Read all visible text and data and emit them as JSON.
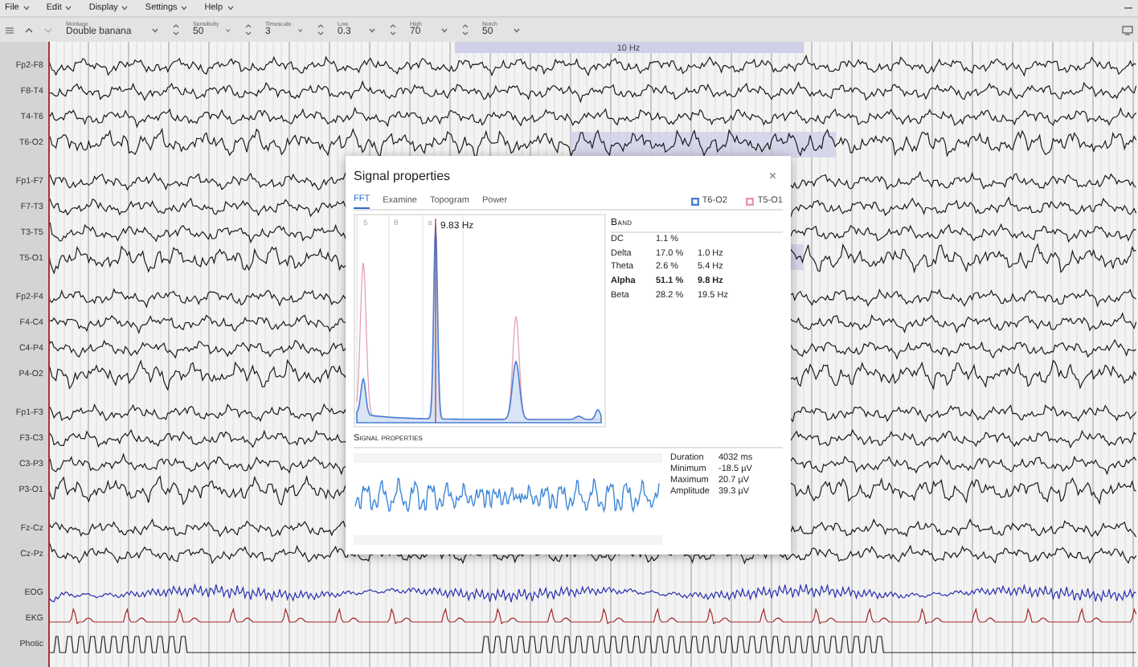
{
  "menu": [
    {
      "label": "File"
    },
    {
      "label": "Edit"
    },
    {
      "label": "Display"
    },
    {
      "label": "Settings"
    },
    {
      "label": "Help"
    }
  ],
  "toolbar": {
    "fields": [
      {
        "label": "Montage",
        "value": "Double banana",
        "kind": "dropdown"
      },
      {
        "label": "Sensitivity",
        "value": "50",
        "kind": "spinner"
      },
      {
        "label": "Timescale",
        "value": "3",
        "kind": "spinner"
      },
      {
        "label": "Low",
        "value": "0.3",
        "kind": "spinner"
      },
      {
        "label": "High",
        "value": "70",
        "kind": "spinner"
      },
      {
        "label": "Notch",
        "value": "50",
        "kind": "spinner"
      }
    ]
  },
  "selection": {
    "label": "10 Hz"
  },
  "montage": {
    "groups": [
      {
        "channels": [
          {
            "name": "Fp2-F8",
            "kind": "eeg"
          },
          {
            "name": "F8-T4",
            "kind": "eeg"
          },
          {
            "name": "T4-T6",
            "kind": "eeg"
          },
          {
            "name": "T6-O2",
            "kind": "eeg"
          }
        ]
      },
      {
        "channels": [
          {
            "name": "Fp1-F7",
            "kind": "eeg"
          },
          {
            "name": "F7-T3",
            "kind": "eeg"
          },
          {
            "name": "T3-T5",
            "kind": "eeg"
          },
          {
            "name": "T5-O1",
            "kind": "eeg"
          }
        ]
      },
      {
        "channels": [
          {
            "name": "Fp2-F4",
            "kind": "eeg"
          },
          {
            "name": "F4-C4",
            "kind": "eeg"
          },
          {
            "name": "C4-P4",
            "kind": "eeg"
          },
          {
            "name": "P4-O2",
            "kind": "eeg"
          }
        ]
      },
      {
        "channels": [
          {
            "name": "Fp1-F3",
            "kind": "eeg"
          },
          {
            "name": "F3-C3",
            "kind": "eeg"
          },
          {
            "name": "C3-P3",
            "kind": "eeg"
          },
          {
            "name": "P3-O1",
            "kind": "eeg"
          }
        ]
      },
      {
        "channels": [
          {
            "name": "Fz-Cz",
            "kind": "eeg"
          },
          {
            "name": "Cz-Pz",
            "kind": "eeg"
          }
        ]
      },
      {
        "channels": [
          {
            "name": "EOG",
            "kind": "eog"
          },
          {
            "name": "EKG",
            "kind": "ekg"
          },
          {
            "name": "Photic",
            "kind": "photic"
          }
        ]
      }
    ]
  },
  "dialog": {
    "title": "Signal properties",
    "close": "×",
    "tabs": [
      {
        "label": "FFT",
        "selected": true
      },
      {
        "label": "Examine",
        "selected": false
      },
      {
        "label": "Topogram",
        "selected": false
      },
      {
        "label": "Power",
        "selected": false
      }
    ],
    "legend": [
      {
        "label": "T6-O2",
        "color": "#4a7fd4"
      },
      {
        "label": "T5-O1",
        "color": "#e39aa8"
      }
    ],
    "fft": {
      "band_markers": [
        "δ",
        "θ",
        "α"
      ],
      "peak_label": "9.83 Hz"
    },
    "bands": {
      "heading": "Band",
      "rows": [
        {
          "name": "DC",
          "percent": "1.1 %",
          "highlighted": false
        },
        {
          "name": "Delta",
          "percent": "17.0 %",
          "frequency": "1.0 Hz",
          "highlighted": false
        },
        {
          "name": "Theta",
          "percent": "2.6 %",
          "frequency": "5.4 Hz",
          "highlighted": false
        },
        {
          "name": "Alpha",
          "percent": "51.1 %",
          "frequency": "9.8 Hz",
          "highlighted": true
        },
        {
          "name": "Beta",
          "percent": "28.2 %",
          "frequency": "19.5 Hz",
          "highlighted": false
        }
      ]
    },
    "signal": {
      "heading": "Signal properties",
      "stats": [
        {
          "label": "Duration",
          "value": "4032 ms"
        },
        {
          "label": "Minimum",
          "value": "-18.5 µV"
        },
        {
          "label": "Maximum",
          "value": "20.7 µV"
        },
        {
          "label": "Amplitude",
          "value": "39.3 µV"
        }
      ]
    }
  }
}
